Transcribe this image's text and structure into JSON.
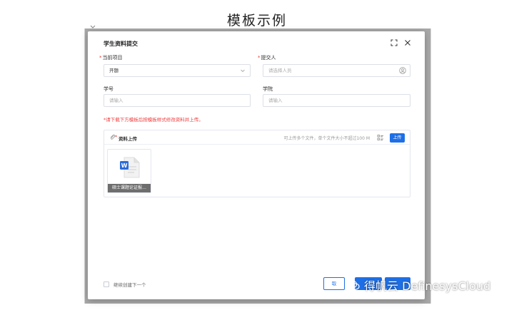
{
  "page_title": "模板示例",
  "dialog": {
    "title": "学生资料提交",
    "fields": {
      "project": {
        "label": "当前项目",
        "value": "开题",
        "required": true
      },
      "submitter": {
        "label": "提交人",
        "placeholder": "请选择人员",
        "required": true
      },
      "student_id": {
        "label": "学号",
        "placeholder": "请输入"
      },
      "college": {
        "label": "学院",
        "placeholder": "请输入"
      }
    },
    "notice": "*请下载下方模板后按模板样式修改资料并上传。",
    "upload": {
      "title": "资料上传",
      "hint": "可上传多个文件，单个文件大小不超过100 M",
      "button_label": "上传",
      "files": [
        {
          "name": "硕士课题论证报…",
          "type": "W"
        }
      ]
    },
    "footer": {
      "continue_label": "继续创建下一个",
      "cancel_label": "取"
    }
  },
  "watermark": "得帆云 DefinesysCloud",
  "colors": {
    "primary": "#1e6fe6",
    "danger": "#f03d3d",
    "overlay": "#a9a9a9"
  }
}
